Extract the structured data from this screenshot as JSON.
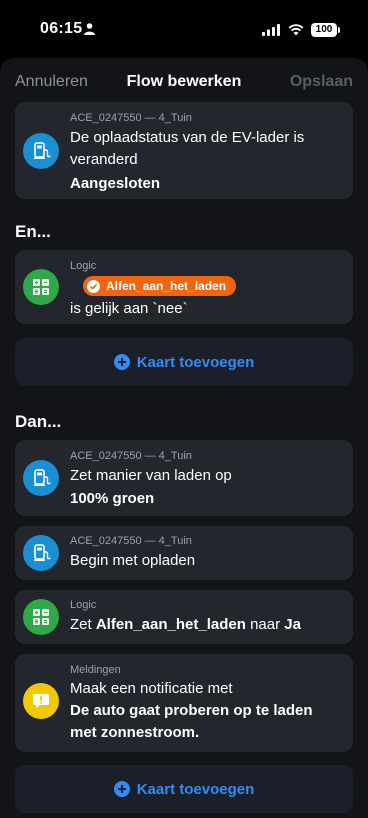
{
  "status_bar": {
    "time": "06:15",
    "battery": "100"
  },
  "nav": {
    "cancel": "Annuleren",
    "title": "Flow bewerken",
    "save": "Opslaan"
  },
  "trigger_card": {
    "meta": "ACE_0247550 — 4_Tuin",
    "line1": "De oplaadstatus van de EV-lader is",
    "line2": "veranderd",
    "value": "Aangesloten"
  },
  "and_section": {
    "title": "En...",
    "logic_card": {
      "meta": "Logic",
      "tag": "Alfen_aan_het_laden",
      "text": "is gelijk aan `nee`"
    },
    "add_label": "Kaart toevoegen"
  },
  "then_section": {
    "title": "Dan...",
    "cards": [
      {
        "meta": "ACE_0247550 — 4_Tuin",
        "line1": "Zet manier van laden op",
        "value": "100% groen"
      },
      {
        "meta": "ACE_0247550 — 4_Tuin",
        "line1": "Begin met opladen"
      },
      {
        "meta": "Logic",
        "prefix": "Zet ",
        "var": "Alfen_aan_het_laden",
        "mid": " naar ",
        "val": "Ja"
      },
      {
        "meta": "Meldingen",
        "line1": "Maak een notificatie met",
        "line2": "De auto gaat proberen op te laden",
        "line3": "met zonnestroom."
      }
    ],
    "add_label": "Kaart toevoegen"
  },
  "colors": {
    "accent": "#2e8ef7",
    "tag": "#f2650f",
    "device": "#1a8fd4",
    "logic": "#2fa84a",
    "notify": "#f2c800"
  }
}
